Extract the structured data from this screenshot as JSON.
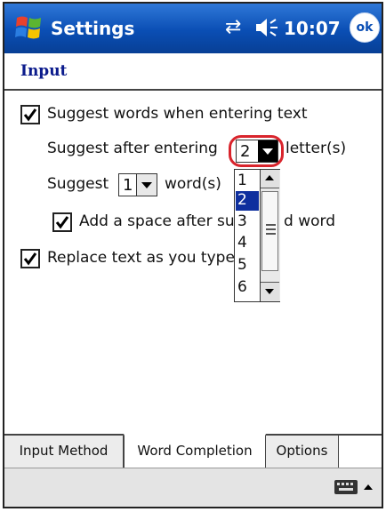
{
  "titlebar": {
    "title": "Settings",
    "time": "10:07",
    "ok_label": "ok",
    "icons": [
      "windows-start-icon",
      "sync-icon",
      "speaker-icon"
    ]
  },
  "heading": "Input",
  "options": {
    "suggest_words": {
      "label": "Suggest words when entering text",
      "checked": true
    },
    "suggest_after_prefix": "Suggest after entering",
    "suggest_after_value": "2",
    "suggest_after_suffix": "letter(s)",
    "suggest_prefix": "Suggest",
    "suggest_count_value": "1",
    "suggest_count_suffix": "word(s)",
    "add_space_label_left": "Add a space after sug",
    "add_space_label_right": "d word",
    "replace_text_label": "Replace text as you type"
  },
  "dropdown": {
    "items": [
      "1",
      "2",
      "3",
      "4",
      "5",
      "6"
    ],
    "selected": "2"
  },
  "tabs": {
    "input_method": "Input Method",
    "word_completion": "Word Completion",
    "options": "Options",
    "active": "Word Completion"
  },
  "colors": {
    "titlebar": "#0a4eb4",
    "selection": "#0e2f9e",
    "highlight_ring": "#d9242c",
    "heading": "#0b1b8c"
  }
}
